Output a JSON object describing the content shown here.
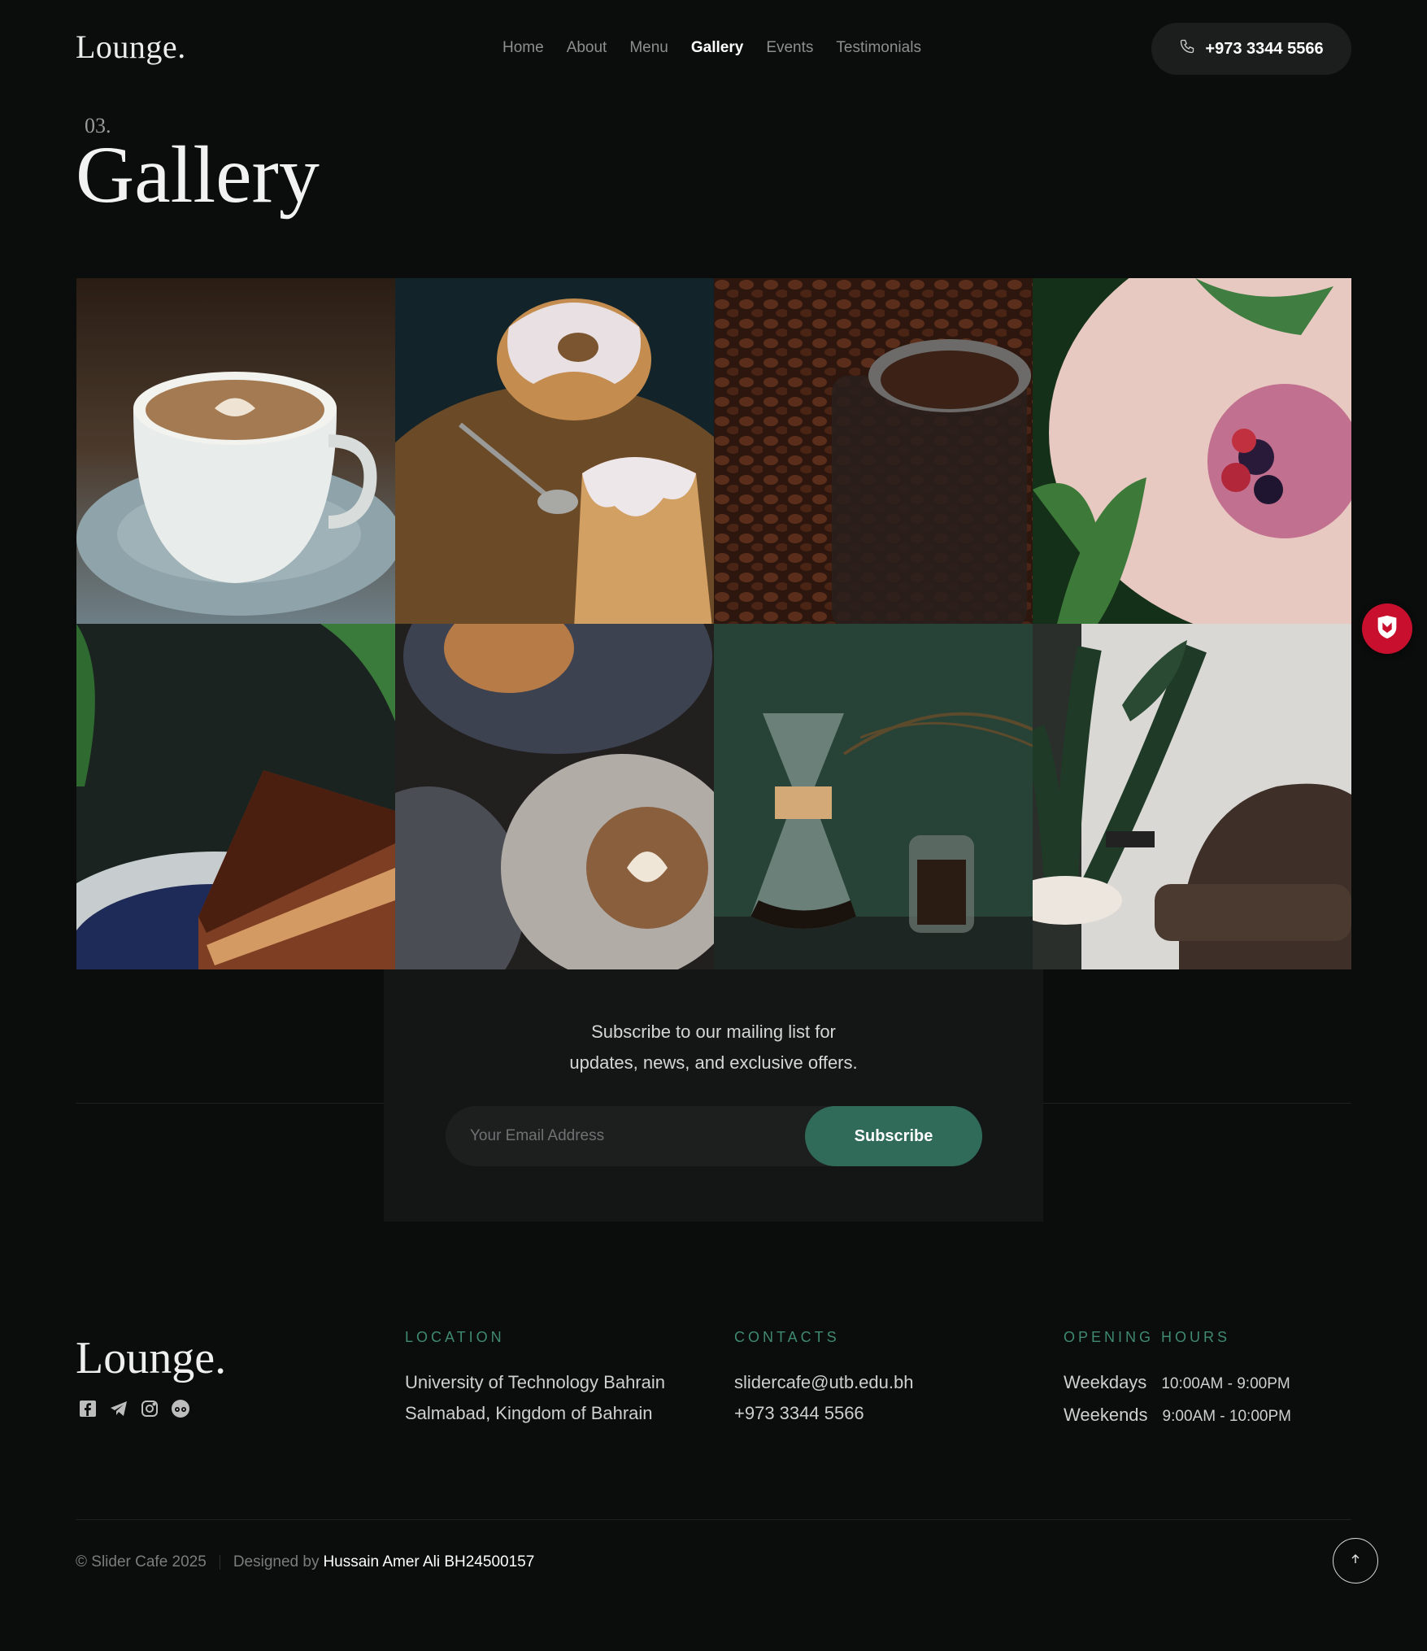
{
  "header": {
    "logo": "Lounge.",
    "nav": [
      "Home",
      "About",
      "Menu",
      "Gallery",
      "Events",
      "Testimonials"
    ],
    "active_nav": "Gallery",
    "phone": "+973 3344 5566"
  },
  "section": {
    "number": "03.",
    "title": "Gallery"
  },
  "gallery": [
    {
      "name": "latte-cup"
    },
    {
      "name": "bundt-cake"
    },
    {
      "name": "coffee-beans-jar"
    },
    {
      "name": "berry-smoothie"
    },
    {
      "name": "chocolate-cake"
    },
    {
      "name": "burger-and-latte"
    },
    {
      "name": "chemex-coffee"
    },
    {
      "name": "lounge-chair-plant"
    }
  ],
  "subscribe": {
    "text_line1": "Subscribe to our mailing list for",
    "text_line2": "updates, news, and exclusive offers.",
    "placeholder": "Your Email Address",
    "button": "Subscribe"
  },
  "footer": {
    "logo": "Lounge.",
    "socials": [
      "facebook-icon",
      "telegram-icon",
      "instagram-icon",
      "tripadvisor-icon"
    ],
    "location": {
      "heading": "LOCATION",
      "line1": "University of Technology Bahrain",
      "line2": "Salmabad, Kingdom of Bahrain"
    },
    "contacts": {
      "heading": "CONTACTS",
      "email": "slidercafe@utb.edu.bh",
      "phone": "+973 3344 5566"
    },
    "hours": {
      "heading": "OPENING HOURS",
      "weekdays_label": "Weekdays",
      "weekdays_time": "10:00AM - 9:00PM",
      "weekends_label": "Weekends",
      "weekends_time": "9:00AM - 10:00PM"
    },
    "copyright": "© Slider Cafe 2025",
    "designed_by": "Designed by",
    "author": "Hussain Amer Ali BH24500157"
  },
  "colors": {
    "background": "#0b0c0c",
    "accent": "#2f6b58",
    "accent_text": "#3f8a70",
    "badge": "#c8102e"
  }
}
